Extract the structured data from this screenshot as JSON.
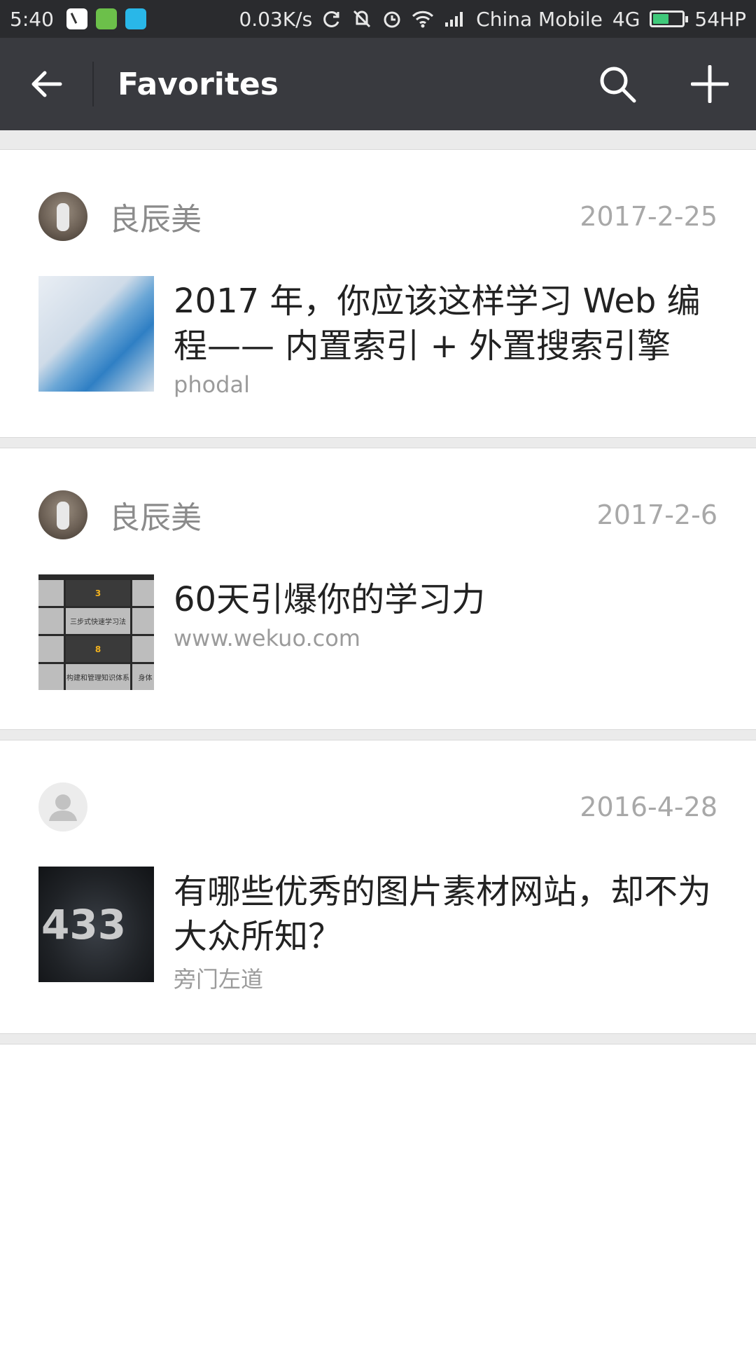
{
  "status_bar": {
    "time": "5:40",
    "net_speed": "0.03K/s",
    "carrier": "China Mobile",
    "network": "4G",
    "battery": "54HP"
  },
  "app_bar": {
    "title": "Favorites",
    "back_icon": "arrow-left-icon",
    "search_icon": "search-icon",
    "add_icon": "plus-icon"
  },
  "items": [
    {
      "author": "良辰美",
      "date": "2017-2-25",
      "title": "2017 年，你应该这样学习 Web 编程—— 内置索引 + 外置搜索引擎",
      "source": "phodal"
    },
    {
      "author": "良辰美",
      "date": "2017-2-6",
      "title": "60天引爆你的学习力",
      "source": "www.wekuo.com",
      "thumb_text": [
        "3",
        "三步式快速学习法",
        "8",
        "构建和管理知识体系",
        "身体"
      ]
    },
    {
      "author": "",
      "date": "2016-4-28",
      "title": "有哪些优秀的图片素材网站，却不为大众所知？",
      "source": "旁门左道",
      "thumb_text": "433"
    }
  ],
  "colors": {
    "status_bar_bg": "#2a2b2e",
    "app_bar_bg": "#393a3f",
    "separator_bg": "#ebebeb",
    "battery_fill": "#3fc97a"
  }
}
